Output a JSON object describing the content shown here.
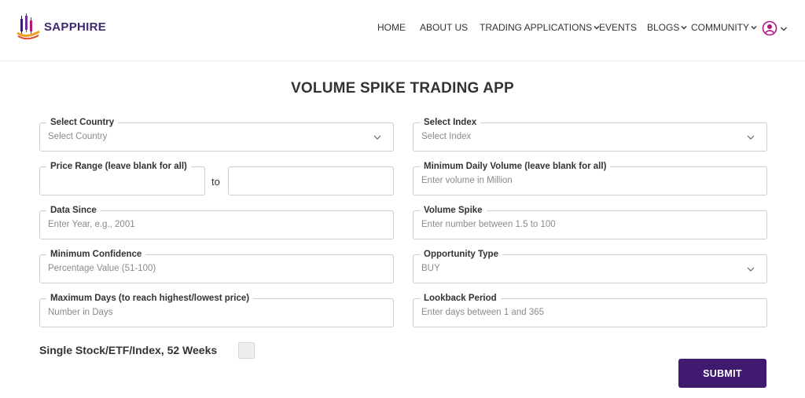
{
  "brand": {
    "name": "SAPPHIRE",
    "accent": "#3f1a6e",
    "icon": "candlestick-logo-icon"
  },
  "nav": {
    "home": "HOME",
    "about": "ABOUT US",
    "trading": "TRADING APPLICATIONS",
    "events": "EVENTS",
    "blogs": "BLOGS",
    "community": "COMMUNITY",
    "user_icon": "user-avatar-icon"
  },
  "title": "VOLUME SPIKE TRADING APP",
  "form": {
    "country": {
      "label": "Select Country",
      "value": "Select Country"
    },
    "index": {
      "label": "Select Index",
      "value": "Select Index"
    },
    "price_range": {
      "label": "Price Range (leave blank for all)",
      "to": "to",
      "from_value": "",
      "to_value": ""
    },
    "min_volume": {
      "label": "Minimum Daily Volume (leave blank for all)",
      "placeholder": "Enter volume in Million"
    },
    "data_since": {
      "label": "Data Since",
      "placeholder": "Enter Year, e.g., 2001"
    },
    "volume_spike": {
      "label": "Volume Spike",
      "placeholder": "Enter number between 1.5 to 100"
    },
    "min_confidence": {
      "label": "Minimum Confidence",
      "placeholder": "Percentage Value (51-100)"
    },
    "opportunity_type": {
      "label": "Opportunity Type",
      "value": "BUY"
    },
    "max_days": {
      "label": "Maximum Days (to reach highest/lowest price)",
      "placeholder": "Number in Days"
    },
    "lookback": {
      "label": "Lookback Period",
      "placeholder": "Enter days between 1 and 365"
    },
    "single_stock": {
      "label": "Single Stock/ETF/Index, 52 Weeks",
      "checked": false
    },
    "submit": "SUBMIT"
  }
}
